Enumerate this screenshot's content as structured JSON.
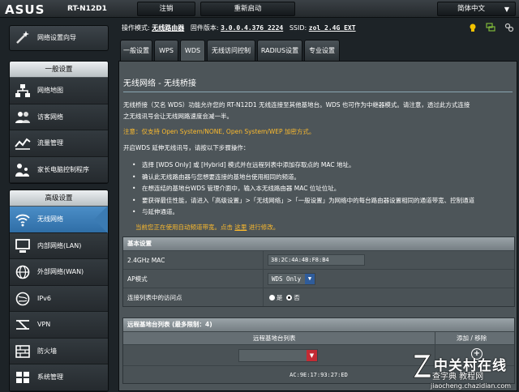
{
  "header": {
    "brand": "ASUS",
    "model": "RT-N12D1",
    "logout": "注销",
    "reboot": "重新启动",
    "language": "简体中文"
  },
  "sidebar": {
    "wizard": "网络设置向导",
    "general_title": "一般设置",
    "general_items": [
      {
        "label": "网络地图",
        "icon": "network-map-icon"
      },
      {
        "label": "访客网络",
        "icon": "guest-network-icon"
      },
      {
        "label": "流量管理",
        "icon": "traffic-manager-icon"
      },
      {
        "label": "家长电脑控制程序",
        "icon": "parental-control-icon"
      }
    ],
    "advanced_title": "高级设置",
    "advanced_items": [
      {
        "label": "无线网络",
        "icon": "wireless-icon"
      },
      {
        "label": "内部网络(LAN)",
        "icon": "lan-icon"
      },
      {
        "label": "外部网络(WAN)",
        "icon": "wan-icon"
      },
      {
        "label": "IPv6",
        "icon": "ipv6-icon"
      },
      {
        "label": "VPN",
        "icon": "vpn-icon"
      },
      {
        "label": "防火墙",
        "icon": "firewall-icon"
      },
      {
        "label": "系统管理",
        "icon": "admin-icon"
      }
    ]
  },
  "status": {
    "mode_label": "操作模式:",
    "mode_value": "无线路由器",
    "fw_label": "固件版本:",
    "fw_value": "3.0.0.4.376_2224",
    "ssid_label": "SSID:",
    "ssid_value": "zol_2.4G_EXT"
  },
  "tabs": [
    "一般设置",
    "WPS",
    "WDS",
    "无线访问控制",
    "RADIUS设置",
    "专业设置"
  ],
  "content": {
    "title": "无线网络 - 无线桥接",
    "intro1": "无线桥接（又名 WDS）功能允许您的 RT-N12D1 无线连接至其他基地台。WDS 也可作为中继器模式。请注意，透过此方式连接",
    "intro2": "之无线讯号会让无线网路速度会减一半。",
    "warning": "注意：仅支持 Open System/NONE, Open System/WEP 加密方式。",
    "steps_intro": "开启WDS 延伸无线讯号，请按以下步骤操作：",
    "steps": [
      "选择 [WDS Only] 或 [Hybrid] 模式并在远程列表中添加存取点的 MAC 地址。",
      "确认此无线路由器与您想要连接的基地台使用相同的频道。",
      "在想连结的基地台WDS 管理介面中，输入本无线路由器 MAC 位址位址。",
      "要获得最佳性能，请进入「高级设置」>「无线网络」>「一般设置」为网络中的每台路由器设置相同的通道带宽、控制通道",
      "与延伸通道。"
    ],
    "note_pre": "当前您正在使用自动频道带宽。点击 ",
    "note_link": "这里",
    "note_post": " 进行修改。"
  },
  "basic": {
    "header": "基本设置",
    "mac_label": "2.4GHz MAC",
    "mac_value": "38:2C:4A:4B:F8:B4",
    "ap_label": "AP模式",
    "ap_value": "WDS Only",
    "conn_label": "连接列表中的访问点",
    "yes": "是",
    "no": "否"
  },
  "remote": {
    "header": "远程基地台列表 (最多限制：4)",
    "col_list": "远程基地台列表",
    "col_action": "添加 / 移除",
    "entry": "AC:9E:17:93:27:ED"
  },
  "watermark": {
    "line1": "中关村在线",
    "line2": "查字典 教程网",
    "line3": "jiaocheng.chazidian.com"
  }
}
